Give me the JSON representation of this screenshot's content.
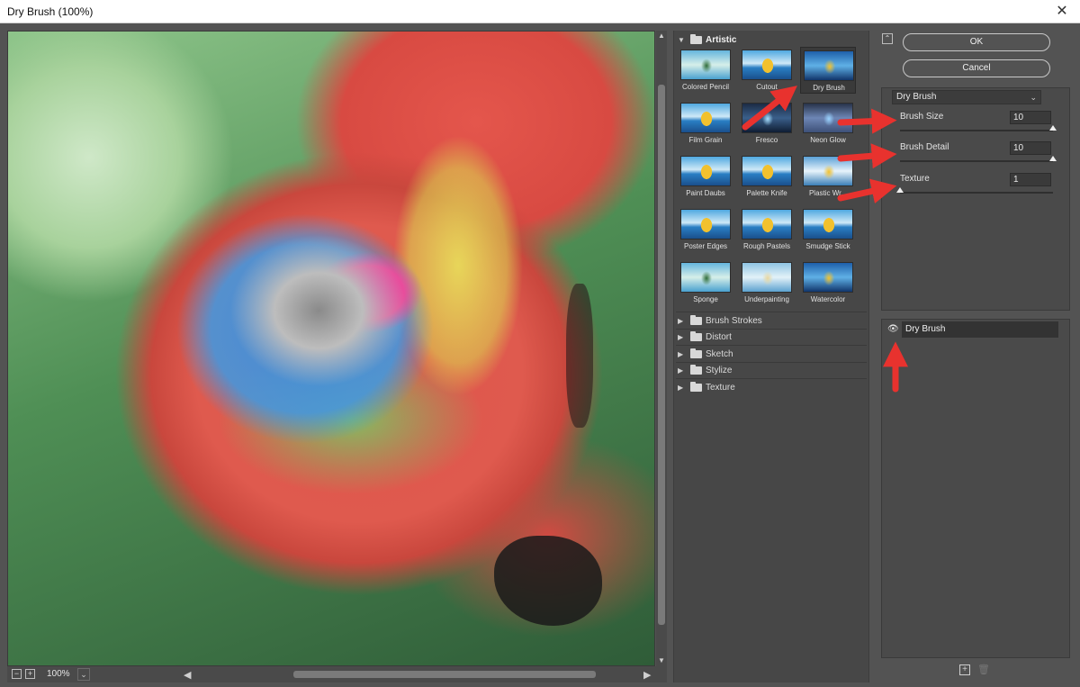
{
  "window": {
    "title": "Dry Brush (100%)",
    "close_glyph": "✕"
  },
  "preview": {
    "zoom_out_glyph": "−",
    "zoom_in_glyph": "+",
    "zoom_label": "100%",
    "zoom_dropdown_glyph": "⌄",
    "scroll_left_glyph": "◀",
    "scroll_right_glyph": "▶",
    "scroll_up_glyph": "▲",
    "scroll_down_glyph": "▼"
  },
  "gallery": {
    "open_category": {
      "label": "Artistic",
      "glyph": "▼"
    },
    "filters": [
      {
        "name": "Colored Pencil",
        "style": "mint"
      },
      {
        "name": "Cutout",
        "style": "default"
      },
      {
        "name": "Dry Brush",
        "style": "water",
        "selected": true
      },
      {
        "name": "Film Grain",
        "style": "default"
      },
      {
        "name": "Fresco",
        "style": "dark"
      },
      {
        "name": "Neon Glow",
        "style": "neon"
      },
      {
        "name": "Paint Daubs",
        "style": "default"
      },
      {
        "name": "Palette Knife",
        "style": "default"
      },
      {
        "name": "Plastic Wr...",
        "style": "plastic"
      },
      {
        "name": "Poster Edges",
        "style": "default"
      },
      {
        "name": "Rough Pastels",
        "style": "default"
      },
      {
        "name": "Smudge Stick",
        "style": "default"
      },
      {
        "name": "Sponge",
        "style": "mint"
      },
      {
        "name": "Underpainting",
        "style": "under"
      },
      {
        "name": "Watercolor",
        "style": "water"
      }
    ],
    "closed_categories": [
      {
        "label": "Brush Strokes",
        "glyph": "▶"
      },
      {
        "label": "Distort",
        "glyph": "▶"
      },
      {
        "label": "Sketch",
        "glyph": "▶"
      },
      {
        "label": "Stylize",
        "glyph": "▶"
      },
      {
        "label": "Texture",
        "glyph": "▶"
      }
    ]
  },
  "settings": {
    "collapse_glyph": "⌃",
    "ok_label": "OK",
    "cancel_label": "Cancel",
    "filter_select": "Dry Brush",
    "filter_select_chevron": "⌄",
    "params": [
      {
        "label": "Brush Size",
        "value": "10",
        "fraction": 1.0
      },
      {
        "label": "Brush Detail",
        "value": "10",
        "fraction": 1.0
      },
      {
        "label": "Texture",
        "value": "1",
        "fraction": 0.0
      }
    ]
  },
  "layers": {
    "items": [
      {
        "name": "Dry Brush",
        "visible": true
      }
    ],
    "eye_glyph": "👁",
    "new_glyph": "+",
    "delete_glyph": "🗑"
  },
  "colors": {
    "panel_bg": "#535353",
    "annotation_red": "#e8322e"
  }
}
